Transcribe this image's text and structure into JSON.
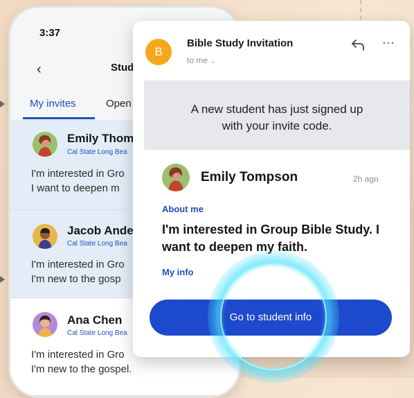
{
  "phone": {
    "status_time": "3:37",
    "nav_title": "Stud",
    "tabs": [
      {
        "label": "My invites",
        "active": true
      },
      {
        "label": "Open"
      }
    ],
    "invites": [
      {
        "name": "Emily Thom",
        "school": "Cal State Long Bea",
        "line1": "I'm interested in Gro",
        "line2": "I want to deepen m",
        "highlighted": true
      },
      {
        "name": "Jacob Ande",
        "school": "Cal State Long Bea",
        "line1": "I'm interested in Gro",
        "line2": "I'm new to the gosp",
        "highlighted": true
      },
      {
        "name": "Ana Chen",
        "school": "Cal State Long Bea",
        "line1": "I'm interested in Gro",
        "line2": "I'm new to the gospel.",
        "highlighted": false
      }
    ]
  },
  "email": {
    "sender_initial": "B",
    "subject": "Bible Study Invitation",
    "recipient": "to me",
    "banner_line1": "A new student has just signed up",
    "banner_line2": "with your invite code.",
    "student": {
      "name": "Emily Tompson",
      "time": "2h ago",
      "about_label": "About me",
      "about_text": "I'm interested in Group Bible Study. I want to deepen my faith.",
      "info_label": "My info"
    },
    "cta_label": "Go to student info"
  },
  "colors": {
    "accent": "#1f4fbf",
    "button": "#1d49cc",
    "sender_avatar": "#f5a81c",
    "highlight_row": "#e3edf7",
    "glow": "#50e1ff"
  },
  "icons": {
    "back": "chevron-left-icon",
    "reply": "reply-icon",
    "more": "more-horizontal-icon",
    "recipient_dropdown": "chevron-down-icon"
  }
}
